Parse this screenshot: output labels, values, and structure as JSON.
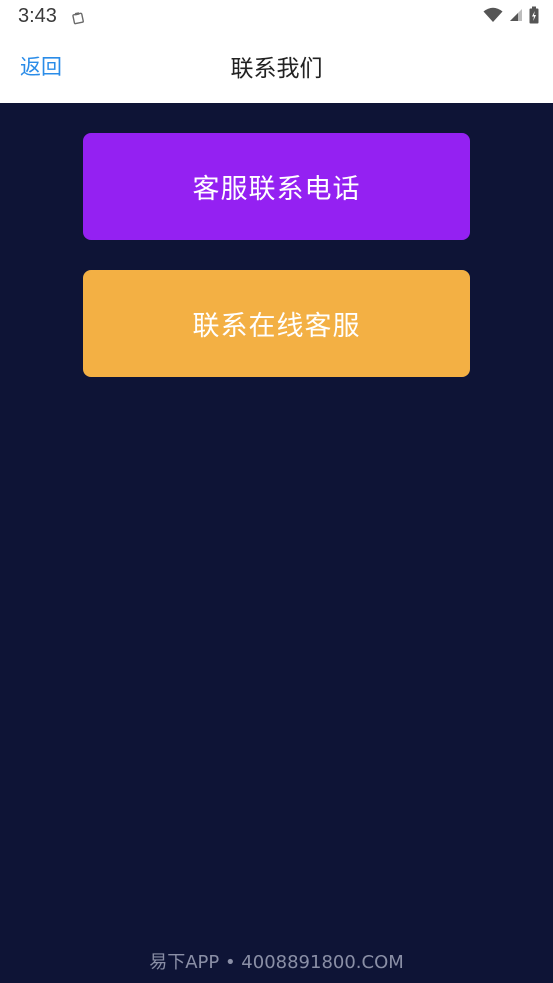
{
  "status_bar": {
    "time": "3:43"
  },
  "nav": {
    "back_label": "返回",
    "title": "联系我们"
  },
  "buttons": {
    "phone_label": "客服联系电话",
    "online_label": "联系在线客服"
  },
  "footer": {
    "text": "易下APP • 4008891800.COM"
  },
  "colors": {
    "background": "#0e1436",
    "phone_button": "#9421f2",
    "online_button": "#f3b044",
    "back_link": "#2a8ce8"
  },
  "icons": {
    "notification": "clipboard-icon",
    "wifi": "wifi-icon",
    "signal": "cell-signal-icon",
    "battery": "battery-icon"
  }
}
